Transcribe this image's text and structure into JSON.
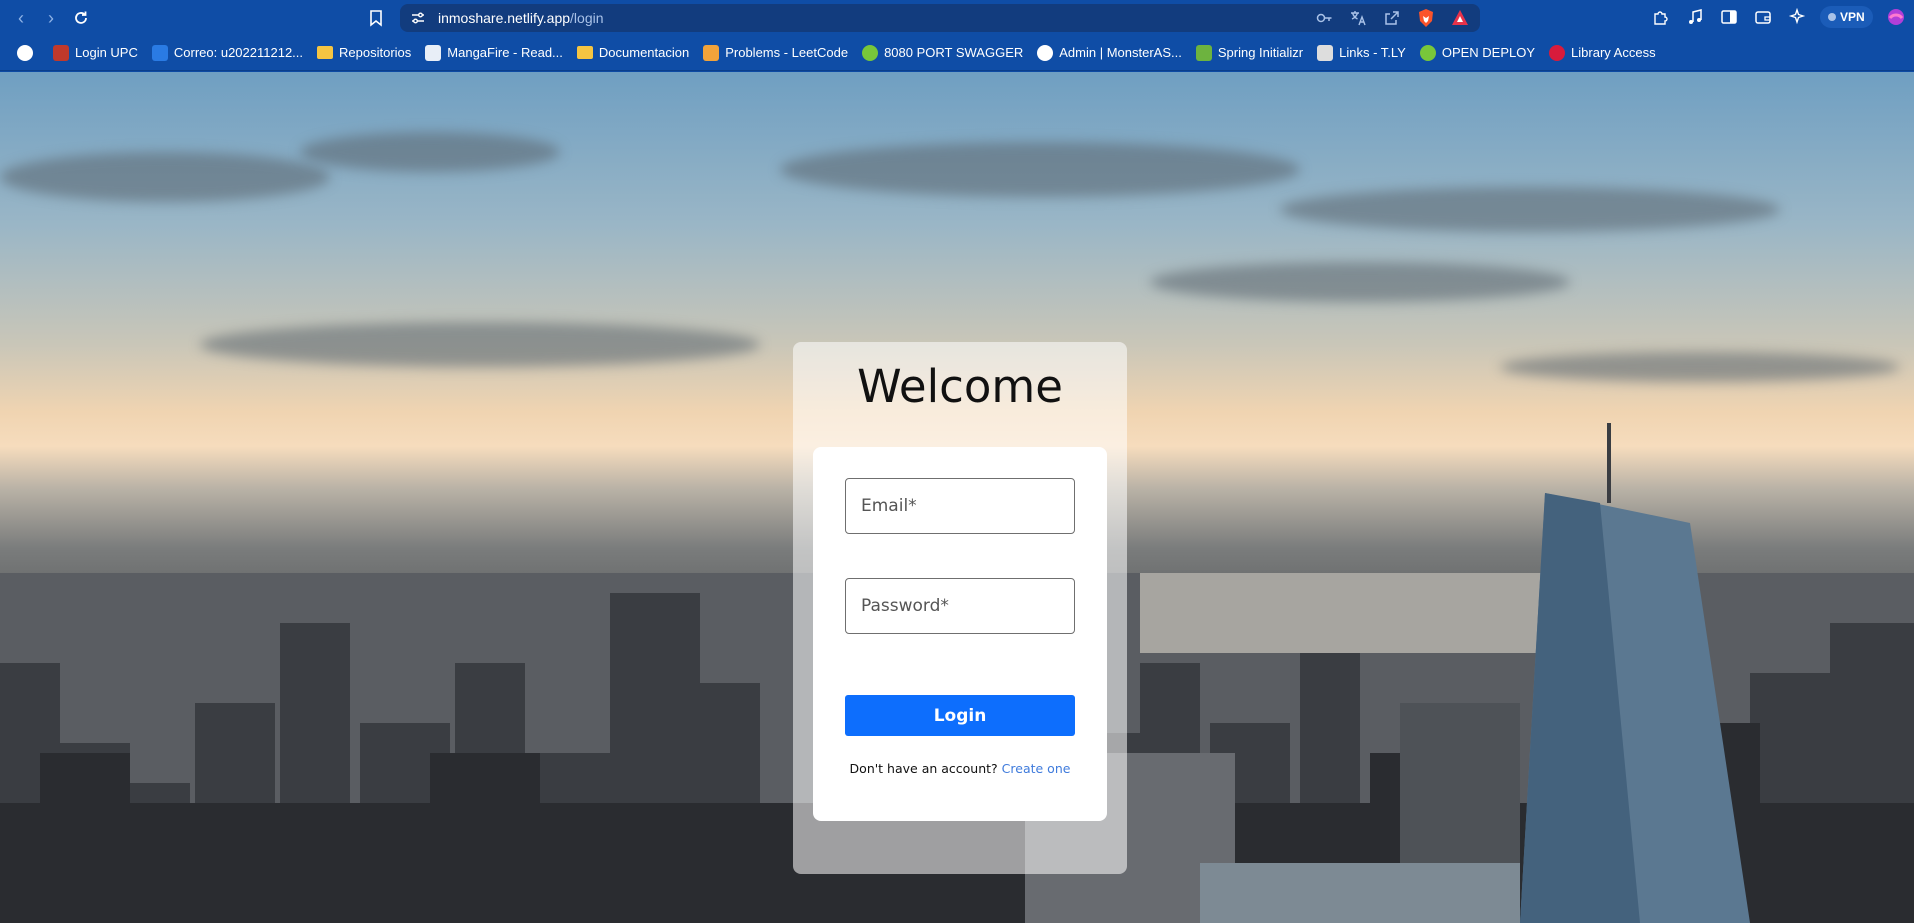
{
  "browser": {
    "url_host": "inmoshare.netlify.app",
    "url_path": "/login",
    "vpn_label": "VPN"
  },
  "bookmarks": [
    {
      "label": "",
      "icon": "globe-icon",
      "color": "#ffffff"
    },
    {
      "label": "Login UPC",
      "icon": "avatar-icon",
      "color": "#c0392b"
    },
    {
      "label": "Correo: u202211212...",
      "icon": "outlook-icon",
      "color": "#2a7be4"
    },
    {
      "label": "Repositorios",
      "icon": "folder-icon",
      "color": "#f5c542"
    },
    {
      "label": "MangaFire - Read...",
      "icon": "manga-icon",
      "color": "#e8eef7"
    },
    {
      "label": "Documentacion",
      "icon": "folder-icon",
      "color": "#f5c542"
    },
    {
      "label": "Problems - LeetCode",
      "icon": "leetcode-icon",
      "color": "#f2a33a"
    },
    {
      "label": "8080 PORT SWAGGER",
      "icon": "swagger-icon",
      "color": "#78c73a"
    },
    {
      "label": "Admin | MonsterAS...",
      "icon": "globe-icon",
      "color": "#ffffff"
    },
    {
      "label": "Spring Initializr",
      "icon": "spring-icon",
      "color": "#6db33f"
    },
    {
      "label": "Links - T.LY",
      "icon": "tly-icon",
      "color": "#dddddd"
    },
    {
      "label": "OPEN DEPLOY",
      "icon": "swagger-icon",
      "color": "#78c73a"
    },
    {
      "label": "Library Access",
      "icon": "library-icon",
      "color": "#d81b3c"
    }
  ],
  "login": {
    "title": "Welcome",
    "email_placeholder": "Email*",
    "password_placeholder": "Password*",
    "button_label": "Login",
    "signup_prompt": "Don't have an account?",
    "signup_link": "Create one"
  },
  "colors": {
    "chrome": "#0f4da6",
    "primary_button": "#0d6efd",
    "link": "#3f7bdc"
  }
}
